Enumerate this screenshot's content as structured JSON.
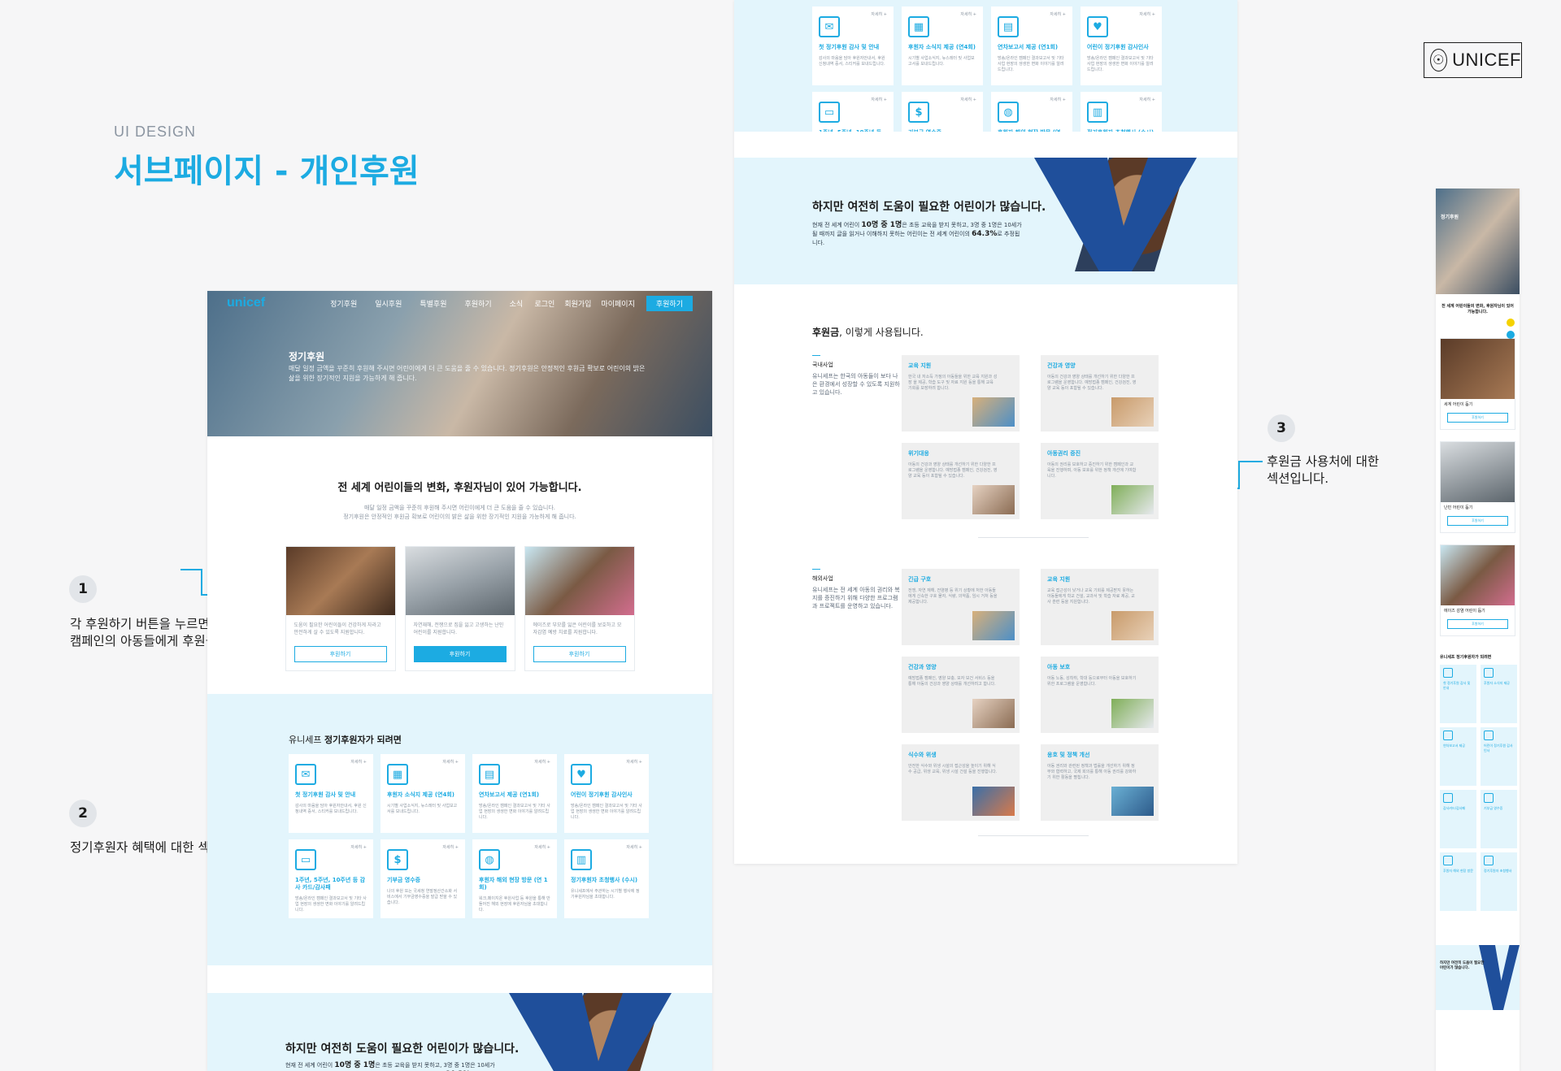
{
  "header": {
    "brand_logo_text": "UNICEF",
    "ui_tag": "UI DESIGN",
    "page_title": "서브페이지 - 개인후원"
  },
  "annotations": [
    {
      "num": "1",
      "text": "각 후원하기 버튼을 누르면 해당\n캠페인의 아동들에게 후원을 할 수 있습니다."
    },
    {
      "num": "2",
      "text": "정기후원자 혜택에 대한 섹션입니다."
    },
    {
      "num": "3",
      "text": "후원금 사용처에 대한\n섹션입니다."
    }
  ],
  "desktop_page": {
    "nav": {
      "brand": "unicef",
      "links": [
        "정기후원",
        "일시후원",
        "특별후원",
        "후원하기",
        "소식"
      ],
      "util": [
        "로그인",
        "회원가입",
        "마이페이지"
      ],
      "donate_button": "후원하기"
    },
    "hero": {
      "title": "정기후원",
      "desc": "매달 일정 금액을 꾸준히 후원해 주시면 어린이에게 더 큰 도움을 줄 수 있습니다. 정기후원은 안정적인 후원금 확보로 어린이의 밝은 삶을 위한 장기적인 지원을 가능하게 해 줍니다."
    },
    "intro": {
      "title": "전 세계 어린이들의 변화, 후원자님이 있어 가능합니다.",
      "desc": "매달 일정 금액을 꾸준히 후원해 주시면 어린이에게 더 큰 도움을 줄 수 있습니다.\n정기후원은 안정적인 후원금 확보로 어린이의 밝은 삶을 위한 장기적인 지원을 가능하게 해 줍니다."
    },
    "campaigns": [
      {
        "text": "도움이 필요한 어린이들이 건강하게 자라고 안전하게 살 수 있도록 지원합니다.",
        "button": "후원하기"
      },
      {
        "text": "자연재해, 전쟁으로 집을 잃고 고생하는 난민 어린이를 지원합니다.",
        "button": "후원하기"
      },
      {
        "text": "에이즈로 부모를 잃은 어린이를 보호하고 모자감염 예방 치료를 지원합니다.",
        "button": "후원하기"
      }
    ],
    "benefits": {
      "heading_prefix": "유니세프 ",
      "heading_bold": "정기후원자가 되려면",
      "more_label": "자세히 +",
      "items": [
        {
          "icon": "mail-icon",
          "glyph": "✉",
          "title": "첫 정기후원 감사 및 안내",
          "desc": "감사의 마음을 담아 후원자안내서, 후원 신청내역 증서, 스티커를 보내드립니다."
        },
        {
          "icon": "map-icon",
          "glyph": "▦",
          "title": "후원자 소식지 제공 (연4회)",
          "desc": "시기별 사업소식지, 뉴스레터 및 사업보고서를 보내드립니다."
        },
        {
          "icon": "report-icon",
          "glyph": "▤",
          "title": "연차보고서 제공 (연1회)",
          "desc": "방송/온라인 캠페인 결과보고서 및 기타 사업 현장의 생생한 변화 이야기를 알려드립니다."
        },
        {
          "icon": "child-icon",
          "glyph": "♥",
          "title": "어린이 정기후원 감사인사",
          "desc": "방송/온라인 캠페인 결과보고서 및 기타 사업 현장의 생생한 변화 이야기를 알려드립니다."
        },
        {
          "icon": "card-icon",
          "glyph": "▭",
          "title": "1주년, 5주년, 10주년 등 감사 카드/감사패",
          "desc": "방송/온라인 캠페인 결과보고서 및 기타 사업 현장의 생생한 변화 이야기를 알려드립니다."
        },
        {
          "icon": "receipt-icon",
          "glyph": "$",
          "title": "기부금 영수증",
          "desc": "나의 후원 또는 국세청 연말정산간소화 서비스에서 기부금영수증을 발급 받을 수 있습니다."
        },
        {
          "icon": "globe-icon",
          "glyph": "◍",
          "title": "후원자 해외 현장 방문 (연 1회)",
          "desc": "워크,페이지온 후원사업 등 후원을 통해 만들어진 해외 현장에 후원자님을 초대합니다."
        },
        {
          "icon": "building-icon",
          "glyph": "▥",
          "title": "정기후원자 초청행사 (수시)",
          "desc": "유니세프에서 주관하는 시기별 행사에 정기후원자님을 초대합니다."
        }
      ]
    },
    "need": {
      "title": "하지만 여전히 도움이 필요한 어린이가 많습니다.",
      "desc_1": "현재 전 세계 어린이 ",
      "desc_bold_1": "10명 중 1명",
      "desc_2": "은 초등 교육을 받지 못하고, 3명 중 1명은 10세가 될 때까지 글을 읽거나 이해하지 못하는 어린이는 전 세계 어린이의 ",
      "desc_bold_2": "64.3%",
      "desc_3": "로 추정됩니다."
    }
  },
  "usage_page": {
    "heading_bold": "후원금",
    "heading_rest": ", 이렇게 사용됩니다.",
    "domestic": {
      "name": "국내사업",
      "desc": "유니세프는 한국의 아동들이 보다 나은 환경에서 성장할 수 있도록 지원하고 있습니다.",
      "cards": [
        {
          "title": "교육 지원",
          "desc": "한국 내 저소득 가정의 아동들을 위한 교육 지원과 성장 을 제공, 학습 도구 및 자료 지원 등을 통해 교육 기회를 보장하려 합니다."
        },
        {
          "title": "건강과 영양",
          "desc": "아동의 건강과 영양 상태를 개선하기 위한 다양한 프로그램을 운영합니다. 예방접종 캠페인, 건강검진, 영양 교육 등이 포함될 수 있습니다."
        },
        {
          "title": "위기대응",
          "desc": "아동의 건강과 영양 상태를 개선하기 위한 다양한 프로그램을 운영합니다. 예방접종 캠페인, 건강검진, 영양 교육 등이 포함될 수 있습니다."
        },
        {
          "title": "아동권리 증진",
          "desc": "아동의 권리를 보호하고 증진하기 위한 캠페인과 교육을 진행하며, 아동 보호를 위한 정책 개선에 기여합니다."
        }
      ]
    },
    "overseas": {
      "name": "해외사업",
      "desc": "유니세프는 전 세계 아동의 권리와 복지를 증진하기 위해 다양한 프로그램과 프로젝트를 운영하고 있습니다.",
      "cards": [
        {
          "title": "긴급 구호",
          "desc": "전쟁, 자연 재해, 전염병 등 위기 상황에 처한 아동들에게 신속한 구호 물자, 식량, 의약품, 임시 거처 등을 제공합니다."
        },
        {
          "title": "교육 지원",
          "desc": "교육 접근성이 낮거나 교육 기회를 제공받지 못하는 아동들에게 학교 건설, 교과서 및 학습 자료 제공, 교사 훈련 등을 지원합니다."
        },
        {
          "title": "건강과 영양",
          "desc": "예방접종 캠페인, 영양 보충, 모자 보건 서비스 등을 통해 아동의 건강과 영양 상태를 개선하려고 합니다."
        },
        {
          "title": "아동 보호",
          "desc": "아동 노동, 성착취, 학대 등으로부터 아동을 보호하기 위한 프로그램을 운영합니다."
        },
        {
          "title": "식수와 위생",
          "desc": "안전한 식수와 위생 시설의 접근성을 높이기 위해 식수 공급, 위생 교육, 위생 시설 건설 등을 진행합니다."
        },
        {
          "title": "옹호 및 정책 개선",
          "desc": "아동 권리와 관련된 정책과 법률을 개선하기 위해 정부와 협력하고, 국제 회의를 통해 아동 권리를 강화하기 위한 활동을 펼칩니다."
        }
      ]
    }
  },
  "mobile_page": {
    "hero_title": "정기후원",
    "intro": "전 세계 어린이들의 변화, 후원자님이 있어 가능합니다.",
    "campaigns": [
      {
        "title": "세계 어린이 돕기",
        "button": "후원하기"
      },
      {
        "title": "난민 어린이 돕기",
        "button": "후원하기"
      },
      {
        "title": "에이즈 감염 어린이 돕기",
        "button": "후원하기"
      }
    ],
    "benefits_title": "유니세프 정기후원자가 되려면",
    "benefit_labels": [
      "첫 정기후원 감사 및 안내",
      "후원자 소식지 제공",
      "연차보고서 제공",
      "어린이 정기후원 감사인사",
      "감사카드/감사패",
      "기부금 영수증",
      "후원자 해외 현장 방문",
      "정기후원자 초청행사"
    ],
    "need_title": "하지만 여전히 도움이 필요한 어린이가 많습니다."
  },
  "colors": {
    "accent": "#1cabe2",
    "light_bg": "#e3f5fc",
    "navy": "#1f4f9b"
  }
}
